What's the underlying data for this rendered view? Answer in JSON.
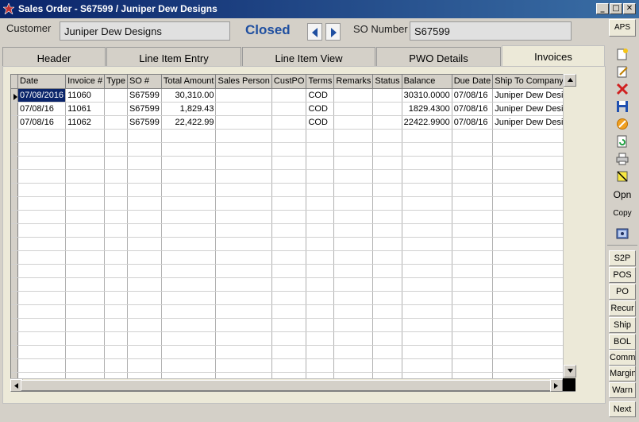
{
  "window": {
    "title": "Sales Order - S67599 / Juniper Dew Designs",
    "controls": [
      "_",
      "□",
      "✕"
    ]
  },
  "header": {
    "customer_label": "Customer",
    "customer_value": "Juniper Dew Designs",
    "status": "Closed",
    "so_number_label": "SO Number",
    "so_number_value": "S67599",
    "aps_label": "APS"
  },
  "tabs": [
    "Header",
    "Line Item Entry",
    "Line Item View",
    "PWO Details",
    "Invoices"
  ],
  "active_tab": "Invoices",
  "grid": {
    "columns": [
      "Date",
      "Invoice #",
      "Type",
      "SO #",
      "Total Amount",
      "Sales Person",
      "CustPO",
      "Terms",
      "Remarks",
      "Status",
      "Balance",
      "Due Date",
      "Ship To Company"
    ],
    "rows": [
      [
        "07/08/2016",
        "11060",
        "",
        "S67599",
        "30,310.00",
        "",
        "",
        "COD",
        "",
        "",
        "30310.0000",
        "07/08/16",
        "Juniper Dew Designs"
      ],
      [
        "07/08/16",
        "11061",
        "",
        "S67599",
        "1,829.43",
        "",
        "",
        "COD",
        "",
        "",
        "1829.4300",
        "07/08/16",
        "Juniper Dew Designs"
      ],
      [
        "07/08/16",
        "11062",
        "",
        "S67599",
        "22,422.99",
        "",
        "",
        "COD",
        "",
        "",
        "22422.9900",
        "07/08/16",
        "Juniper Dew Designs"
      ]
    ],
    "empty_rows": 19
  },
  "sidebar": {
    "icons": [
      "new-document-icon",
      "edit-icon",
      "delete-icon",
      "save-icon",
      "cancel-icon",
      "refresh-icon",
      "print-icon",
      "note-icon"
    ],
    "text_buttons_top": [
      "Opn",
      "Copy"
    ],
    "image_button": "picture-icon",
    "text_buttons": [
      "S2P",
      "POS",
      "PO",
      "Recur",
      "Ship",
      "BOL",
      "Comm",
      "Margin",
      "Warn",
      "Next"
    ]
  },
  "colors": {
    "title_bar": "#0a246a",
    "status": "#1f4fa0",
    "selection": "#0a246a"
  }
}
